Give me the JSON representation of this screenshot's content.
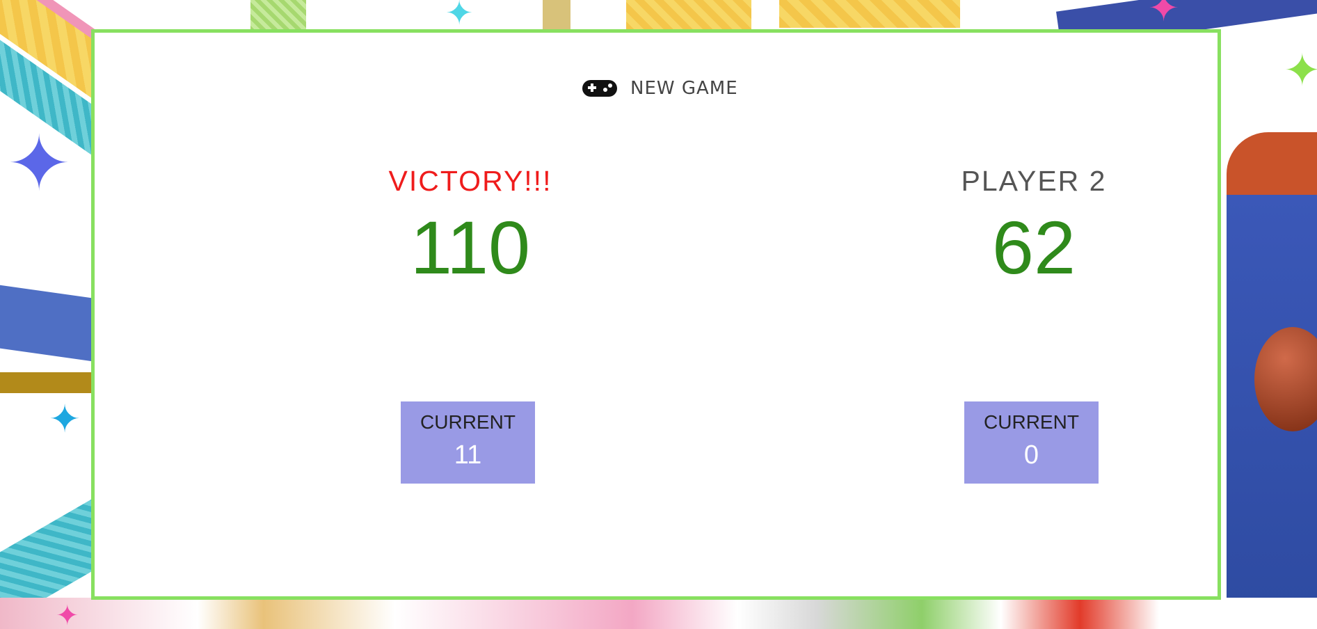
{
  "new_game": {
    "label": "NEW GAME",
    "icon": "gamepad-icon"
  },
  "player1": {
    "name": "VICTORY!!!",
    "score": "110",
    "current_label": "CURRENT",
    "current_value": "11",
    "winner": true
  },
  "player2": {
    "name": "PLAYER 2",
    "score": "62",
    "current_label": "CURRENT",
    "current_value": "0",
    "winner": false
  },
  "colors": {
    "panel_border": "#88e060",
    "score": "#2f8a1b",
    "victory": "#ef1c1c",
    "current_box": "#999ae5"
  }
}
